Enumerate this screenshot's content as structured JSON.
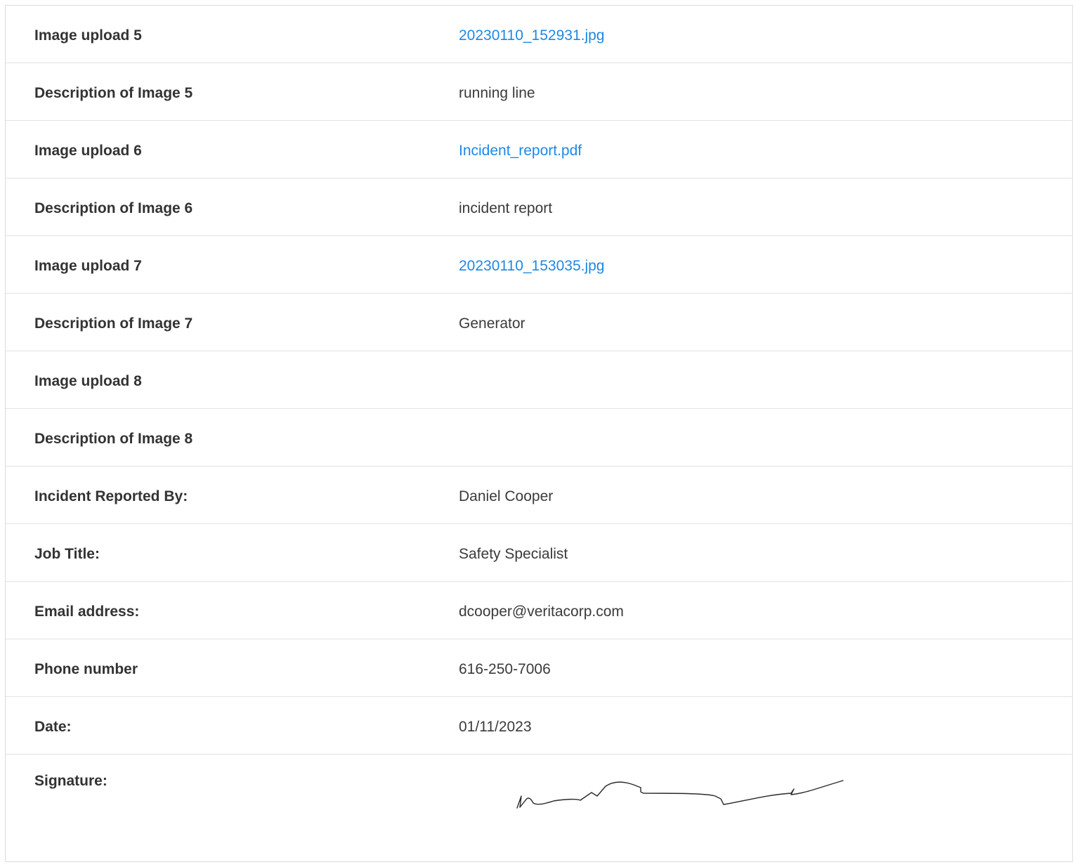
{
  "rows": [
    {
      "label": "Image upload 5",
      "value": "20230110_152931.jpg",
      "link": true
    },
    {
      "label": "Description of Image 5",
      "value": "running line",
      "link": false
    },
    {
      "label": "Image upload 6",
      "value": "Incident_report.pdf",
      "link": true
    },
    {
      "label": "Description of Image 6",
      "value": "incident report",
      "link": false
    },
    {
      "label": "Image upload 7",
      "value": "20230110_153035.jpg",
      "link": true
    },
    {
      "label": "Description of Image 7",
      "value": "Generator",
      "link": false
    },
    {
      "label": "Image upload 8",
      "value": "",
      "link": false
    },
    {
      "label": "Description of Image 8",
      "value": "",
      "link": false
    },
    {
      "label": "Incident Reported By:",
      "value": "Daniel Cooper",
      "link": false
    },
    {
      "label": "Job Title:",
      "value": "Safety Specialist",
      "link": false
    },
    {
      "label": "Email address:",
      "value": "dcooper@veritacorp.com",
      "link": false
    },
    {
      "label": "Phone number",
      "value": "616-250-7006",
      "link": false
    },
    {
      "label": "Date:",
      "value": "01/11/2023",
      "link": false
    }
  ],
  "signature": {
    "label": "Signature:"
  },
  "colors": {
    "link": "#1e88e5",
    "label": "#333333",
    "value": "#3a3a3a",
    "border": "#e3e3e3"
  }
}
